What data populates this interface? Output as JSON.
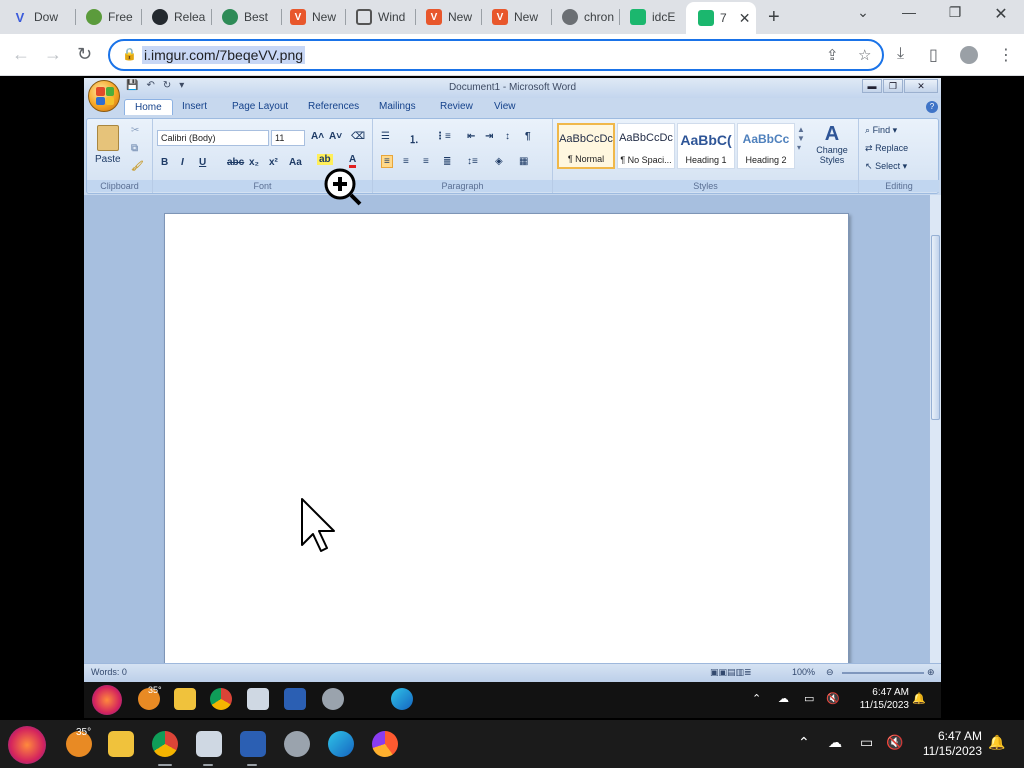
{
  "browser": {
    "tabs": [
      {
        "label": "Dow",
        "icon": "vulcan-icon",
        "color": "#3b5bdb"
      },
      {
        "label": "Free",
        "icon": "leaf-icon",
        "color": "#5b9b3c"
      },
      {
        "label": "Relea",
        "icon": "github-icon",
        "color": "#24292f"
      },
      {
        "label": "Best",
        "icon": "green-circle-icon",
        "color": "#2e8b57"
      },
      {
        "label": "New",
        "icon": "v-logo-icon",
        "color": "#e8572c"
      },
      {
        "label": "Wind",
        "icon": "window-icon",
        "color": "#555555"
      },
      {
        "label": "New",
        "icon": "v-logo-icon",
        "color": "#e8572c"
      },
      {
        "label": "New",
        "icon": "v-logo-icon",
        "color": "#e8572c"
      },
      {
        "label": "chron",
        "icon": "globe-icon",
        "color": "#6b6f74"
      },
      {
        "label": "idcE",
        "icon": "imgur-green-icon",
        "color": "#1bb76e"
      },
      {
        "label": "7",
        "icon": "imgur-green-icon",
        "color": "#1bb76e"
      }
    ],
    "url": "i.imgur.com/7beqeVV.png"
  },
  "word": {
    "title": "Document1 - Microsoft Word",
    "ribbon_tabs": [
      "Home",
      "Insert",
      "Page Layout",
      "References",
      "Mailings",
      "Review",
      "View"
    ],
    "font_name": "Calibri (Body)",
    "font_size": "11",
    "paste_label": "Paste",
    "groups": {
      "clipboard": "Clipboard",
      "font": "Font",
      "paragraph": "Paragraph",
      "styles": "Styles",
      "editing": "Editing"
    },
    "styles": [
      {
        "sample": "AaBbCcDc",
        "name": "¶ Normal"
      },
      {
        "sample": "AaBbCcDc",
        "name": "¶ No Spaci..."
      },
      {
        "sample": "AaBbC(",
        "name": "Heading 1"
      },
      {
        "sample": "AaBbCc",
        "name": "Heading 2"
      }
    ],
    "change_styles": "Change Styles",
    "editing": {
      "find": "Find",
      "replace": "Replace",
      "select": "Select"
    },
    "status_words": "Words: 0",
    "zoom": "100%"
  },
  "inner_taskbar": {
    "time": "6:47 AM",
    "date": "11/15/2023",
    "weather": "35°"
  },
  "taskbar": {
    "time": "6:47 AM",
    "date": "11/15/2023",
    "weather": "35°"
  }
}
